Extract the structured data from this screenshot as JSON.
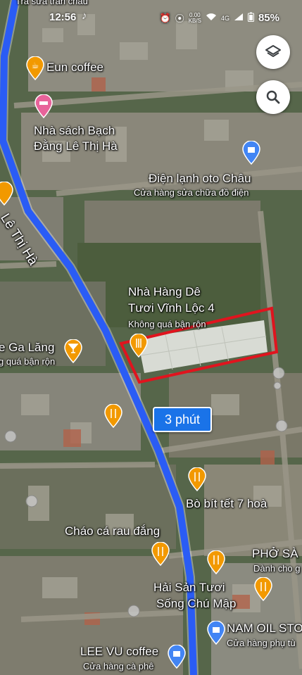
{
  "status_bar": {
    "time": "12:56",
    "network_speed": "0.00",
    "network_unit": "KB/S",
    "signal": "4G",
    "battery": "85%"
  },
  "route": {
    "duration": "3 phút",
    "color": "#2a5cf5"
  },
  "highlight_box_color": "#e0141e",
  "streets": {
    "main_road": "Lê Thị Hà"
  },
  "places": {
    "top_cut": "Trà sữa trân châu",
    "eun_coffee": "Eun coffee",
    "bookstore_line1": "Nhà sách Bạch",
    "bookstore_line2": "Đằng Lê Thị Hà",
    "dien_lanh": "Điện lạnh oto Châu",
    "dien_lanh_sub": "Cửa hàng sửa chữa đồ điện",
    "nha_hang_line1": "Nhà Hàng Dê",
    "nha_hang_line2": "Tươi Vĩnh Lộc 4",
    "nha_hang_sub": "Không quá bận rộn",
    "ga_lang": "e Ga Lăng",
    "ga_lang_sub": "g quá bận rộn",
    "bo_bit_tet": "Bò bít tết 7 hoà",
    "chao_ca": "Cháo cá rau đắng",
    "pho": "PHỞ SÀ",
    "pho_sub": "Dành cho g",
    "hai_san_line1": "Hải Sản Tươi",
    "hai_san_line2": "Sống Chú Mập",
    "nam_oil": "NAM OIL STO",
    "nam_oil_sub": "Cửa hàng phụ tù",
    "lee_vu": "LEE VU coffee",
    "lee_vu_sub": "Cửa hàng cà phê"
  },
  "icons": {
    "layers": "layers-icon",
    "search": "search-icon",
    "restaurant": "restaurant-icon",
    "cafe": "cafe-icon",
    "bar": "bar-icon",
    "hotel": "hotel-icon",
    "shopping": "shopping-icon"
  },
  "colors": {
    "restaurant_pin": "#f29900",
    "shopping_pin": "#4285f4",
    "hotel_pin": "#e8639a"
  }
}
